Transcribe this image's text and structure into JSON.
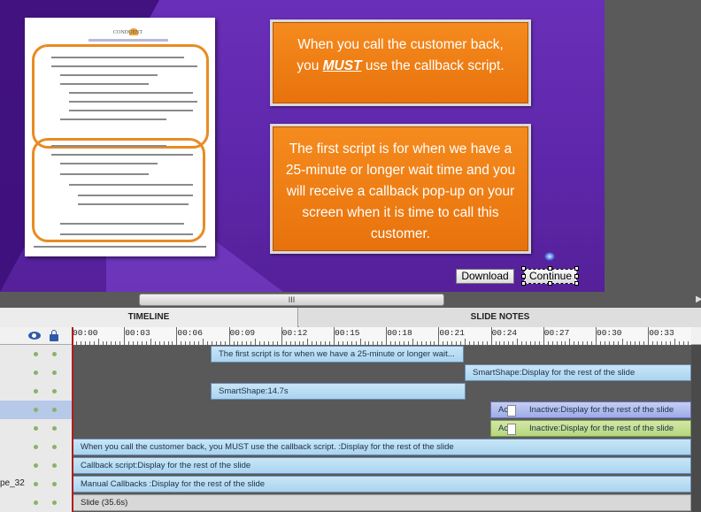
{
  "stage": {
    "callout_top": {
      "before": "When you call the customer back,",
      "you": "you ",
      "must": "MUST",
      "after": " use the callback script."
    },
    "callout_bottom": "The first script is for when we have a 25-minute or longer wait time and you will receive a callback pop-up on your screen when it is time to call this customer.",
    "download_label": "Download",
    "continue_label": "Continue",
    "doc_logo": "CONDUENT"
  },
  "scrollbar": {
    "grip": "III",
    "arrow": "▶"
  },
  "tabs": {
    "timeline": "TIMELINE",
    "slide_notes": "SLIDE NOTES"
  },
  "ruler": {
    "ticks": [
      "00:00",
      "00:03",
      "00:06",
      "00:09",
      "00:12",
      "00:15",
      "00:18",
      "00:21",
      "00:24",
      "00:27",
      "00:30",
      "00:33"
    ]
  },
  "rows": [
    {
      "label": "",
      "bar": "The first script is for when we have a 25-minute or longer wait..."
    },
    {
      "label": "",
      "bar": "SmartShape:Display for the rest of the slide"
    },
    {
      "label": "",
      "bar": "SmartShape:14.7s"
    },
    {
      "label": "",
      "mini": "Ac",
      "bar": "Inactive:Display for the rest of the slide"
    },
    {
      "label": "",
      "mini": "Ac",
      "bar": "Inactive:Display for the rest of the slide"
    },
    {
      "label": "",
      "bar": "When you call the customer back, you MUST use the callback script. :Display for the rest of the slide"
    },
    {
      "label": "",
      "bar": "Callback script:Display for the rest of the slide"
    },
    {
      "label": "pe_32",
      "bar": "Manual Callbacks :Display for the rest of the slide"
    },
    {
      "label": "",
      "bar": "Slide (35.6s)"
    }
  ]
}
